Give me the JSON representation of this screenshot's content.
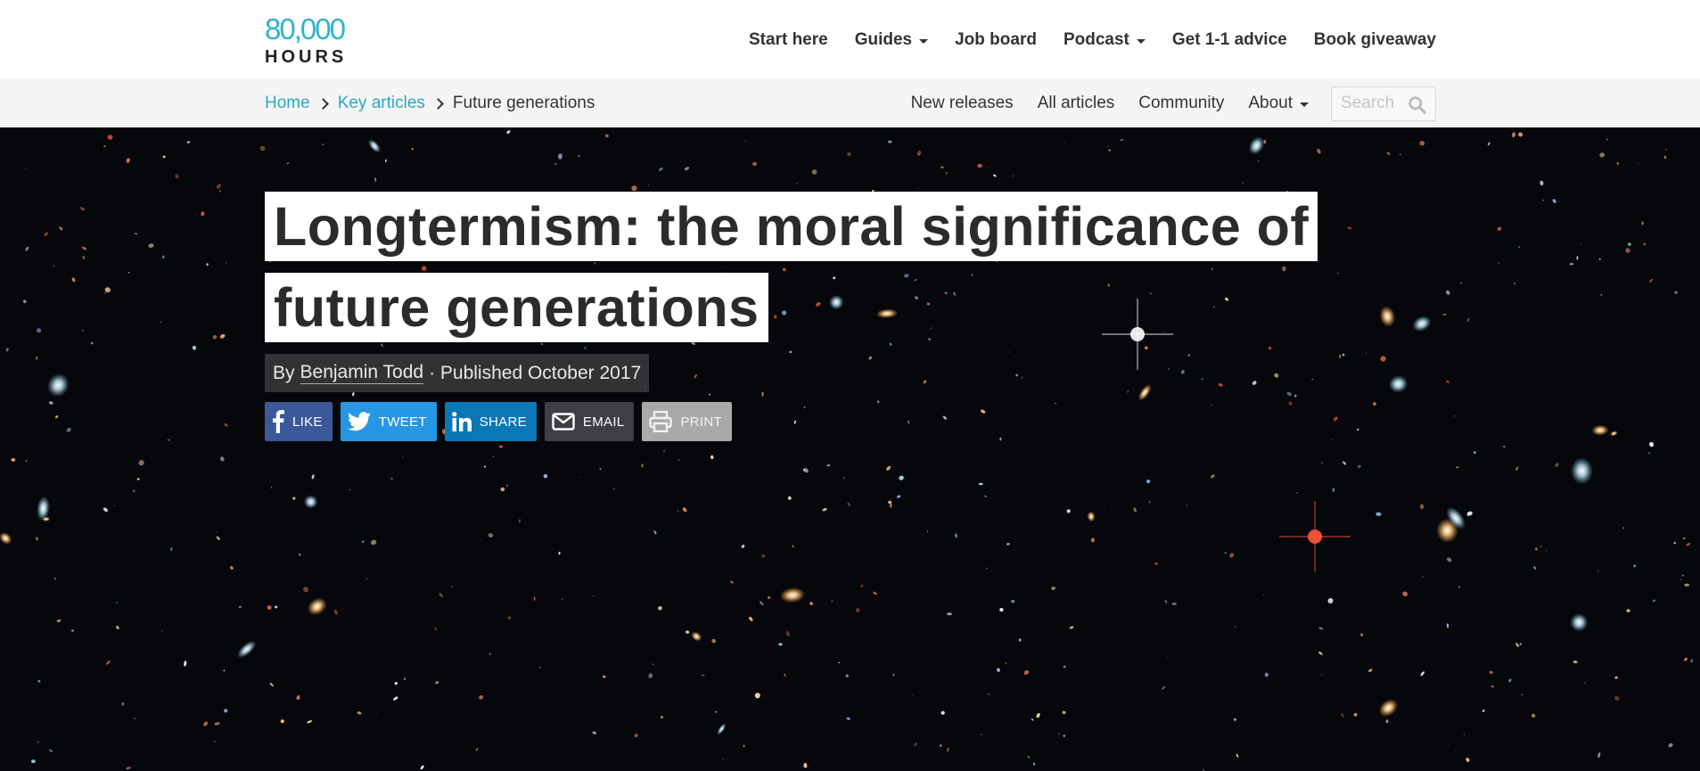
{
  "brand": {
    "logo_number": "80,000",
    "logo_word": "HOURS",
    "accent_color": "#2fb4cc"
  },
  "main_nav": {
    "items": [
      {
        "label": "Start here",
        "has_dropdown": false
      },
      {
        "label": "Guides",
        "has_dropdown": true
      },
      {
        "label": "Job board",
        "has_dropdown": false
      },
      {
        "label": "Podcast",
        "has_dropdown": true
      },
      {
        "label": "Get 1-1 advice",
        "has_dropdown": false
      },
      {
        "label": "Book giveaway",
        "has_dropdown": false
      }
    ]
  },
  "breadcrumb": {
    "home": "Home",
    "section": "Key articles",
    "current": "Future generations"
  },
  "sub_nav": {
    "items": [
      {
        "label": "New releases",
        "has_dropdown": false
      },
      {
        "label": "All articles",
        "has_dropdown": false
      },
      {
        "label": "Community",
        "has_dropdown": false
      },
      {
        "label": "About",
        "has_dropdown": true
      }
    ],
    "search_placeholder": "Search",
    "search_icon": "search-icon"
  },
  "article": {
    "title_line_1": "Longtermism: the moral significance of",
    "title_line_2": "future generations",
    "by_prefix": "By",
    "author": "Benjamin Todd",
    "published": "· Published October 2017"
  },
  "share": {
    "like": "LIKE",
    "tweet": "TWEET",
    "share": "SHARE",
    "email": "EMAIL",
    "print": "PRINT"
  },
  "colors": {
    "facebook": "#3b5998",
    "twitter": "#2796e4",
    "linkedin": "#0b77b5",
    "email": "#3d3f42",
    "print": "#a9a9a9",
    "hero_background": "#05070b"
  }
}
